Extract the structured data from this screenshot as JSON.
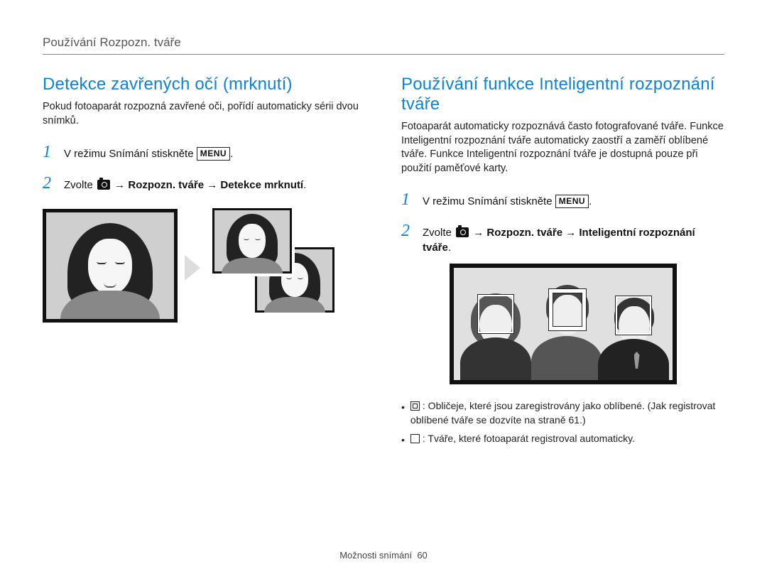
{
  "header": {
    "breadcrumb": "Používání Rozpozn. tváře"
  },
  "left": {
    "title": "Detekce zavřených očí (mrknutí)",
    "intro": "Pokud fotoaparát rozpozná zavřené oči, pořídí automaticky sérii dvou snímků.",
    "step1_prefix": "V režimu Snímání stiskněte ",
    "menu_label": "MENU",
    "step1_suffix": ".",
    "step2_prefix": "Zvolte ",
    "step2_mid1": " → ",
    "step2_b1": "Rozpozn. tváře",
    "step2_mid2": " → ",
    "step2_b2": "Detekce mrknutí",
    "step2_suffix": "."
  },
  "right": {
    "title": "Používání funkce Inteligentní rozpoznání tváře",
    "intro": "Fotoaparát automaticky rozpoznává často fotografované tváře. Funkce Inteligentní rozpoznání tváře automaticky zaostří a zaměří oblíbené tváře. Funkce Inteligentní rozpoznání tváře je dostupná pouze při použití paměťové karty.",
    "step1_prefix": "V režimu Snímání stiskněte ",
    "menu_label": "MENU",
    "step1_suffix": ".",
    "step2_prefix": "Zvolte ",
    "step2_mid1": " → ",
    "step2_b1": "Rozpozn. tváře",
    "step2_mid2": " → ",
    "step2_b2": "Inteligentní rozpoznání tváře",
    "step2_suffix": ".",
    "bullet1": ": Obličeje, které jsou zaregistrovány jako oblíbené. (Jak registrovat oblíbené tváře se dozvíte na straně 61.)",
    "bullet2": ": Tváře, které fotoaparát registroval automaticky."
  },
  "nums": {
    "one": "1",
    "two": "2"
  },
  "footer": {
    "section": "Možnosti snímání",
    "page": "60"
  }
}
